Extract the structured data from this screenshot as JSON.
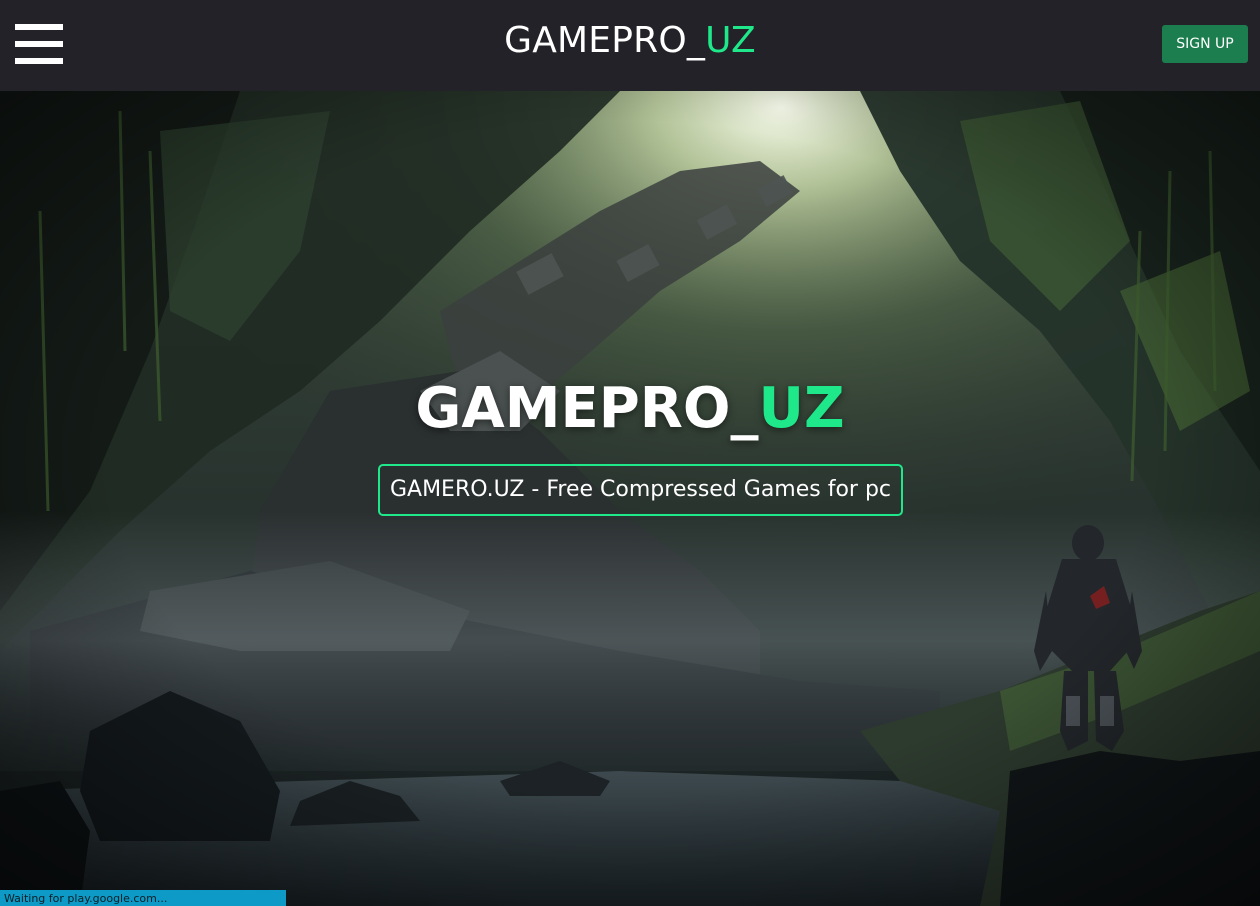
{
  "header": {
    "menu_icon": "hamburger-menu-icon",
    "brand_main": "GAMEPRO_",
    "brand_accent": "UZ",
    "signup_label": "SIGN UP"
  },
  "hero": {
    "title_main": "GAMEPRO_",
    "title_accent": "UZ",
    "tagline": "GAMERO.UZ - Free Compressed Games for pc"
  },
  "status": {
    "text": "Waiting for play.google.com..."
  },
  "colors": {
    "navbar_bg": "#232228",
    "accent_green": "#1ee88a",
    "signup_bg": "#1c7d4e",
    "status_bg": "#0e9ac6"
  }
}
